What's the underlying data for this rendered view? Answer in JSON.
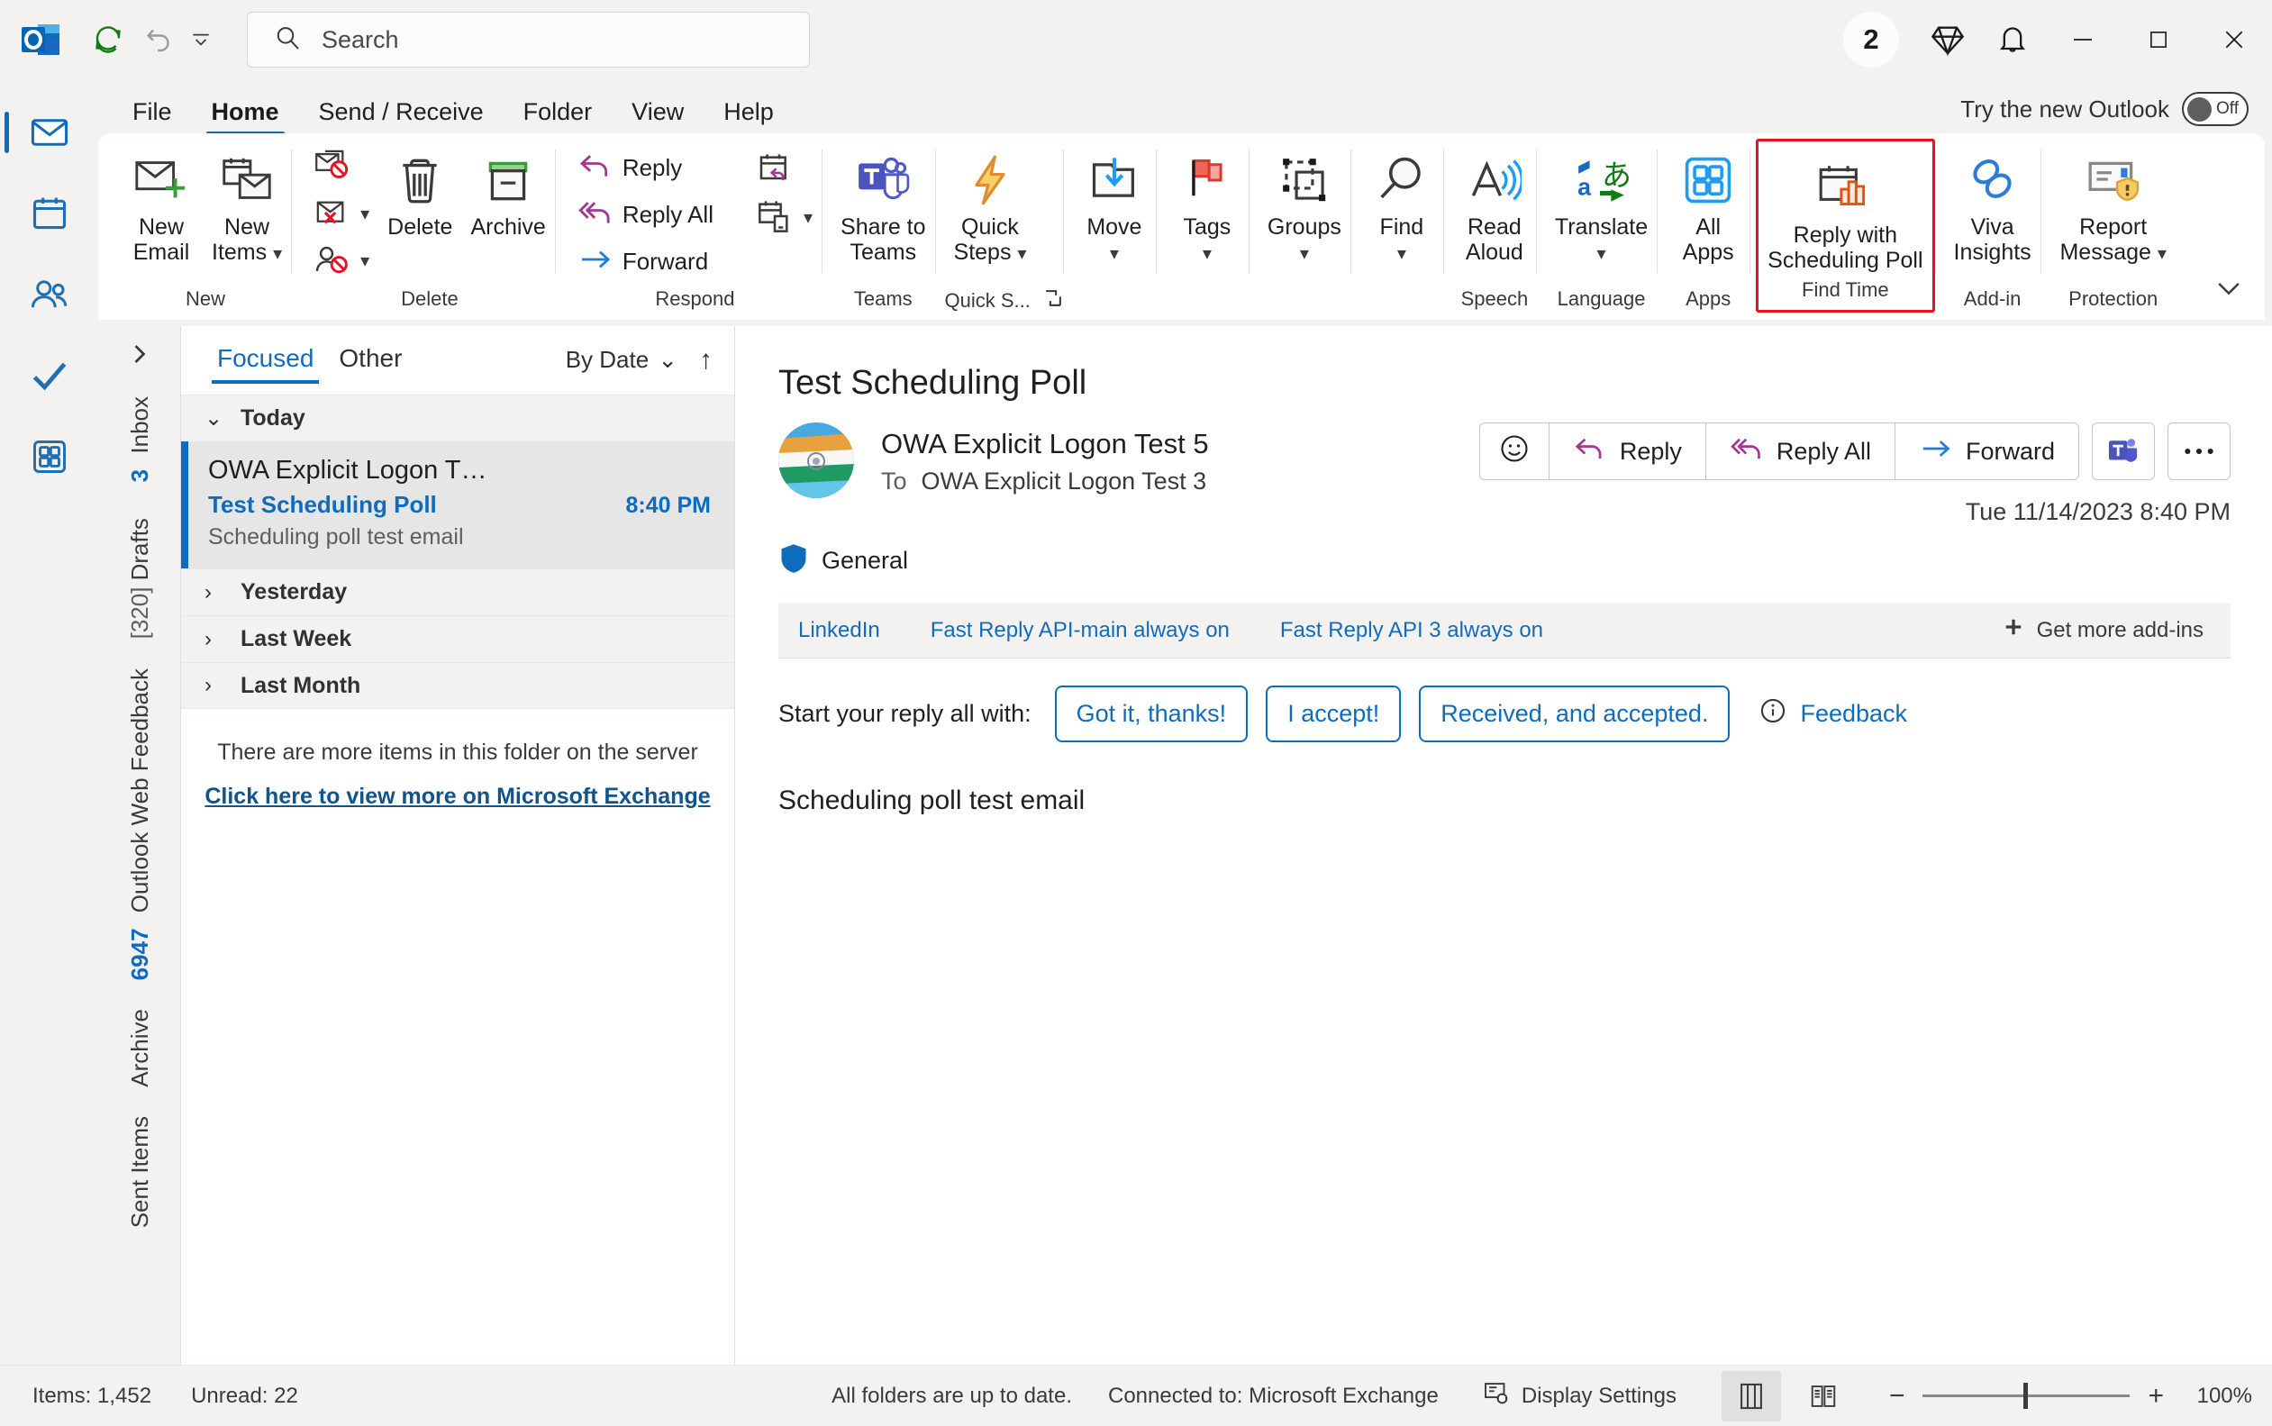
{
  "titlebar": {
    "logo_icon": "outlook-logo-icon",
    "quick_access": [
      {
        "name": "send-receive-all-icon",
        "label": "Send/Receive All Folders"
      },
      {
        "name": "undo-icon",
        "label": "Undo"
      },
      {
        "name": "customize-quick-access-toolbar-icon",
        "label": "Customize Quick Access Toolbar"
      }
    ],
    "search": {
      "placeholder": "Search",
      "icon": "search-icon"
    },
    "badge_count": "2",
    "right_icons": [
      {
        "name": "diamond-icon"
      },
      {
        "name": "bell-notification-icon"
      }
    ],
    "window_controls": {
      "minimize": "─",
      "maximize": "□",
      "close": "✕"
    }
  },
  "tabs": {
    "items": [
      {
        "label": "File",
        "active": false
      },
      {
        "label": "Home",
        "active": true
      },
      {
        "label": "Send / Receive",
        "active": false
      },
      {
        "label": "Folder",
        "active": false
      },
      {
        "label": "View",
        "active": false
      },
      {
        "label": "Help",
        "active": false
      }
    ],
    "new_outlook": {
      "label": "Try the new Outlook",
      "state": "Off"
    }
  },
  "ribbon": {
    "groups": [
      {
        "name": "new",
        "label": "New",
        "buttons": [
          {
            "name": "new-email-button",
            "label": "New\nEmail",
            "icon": "new-email-icon"
          },
          {
            "name": "new-items-button",
            "label": "New\nItems",
            "icon": "new-items-icon",
            "dropdown": true
          }
        ]
      },
      {
        "name": "delete",
        "label": "Delete",
        "small_buttons": [
          {
            "name": "ignore-button",
            "label": "",
            "icon": "ignore-icon"
          },
          {
            "name": "junk-button",
            "label": "",
            "icon": "junk-icon",
            "dropdown": true
          },
          {
            "name": "block-sender-button",
            "label": "",
            "icon": "block-sender-icon",
            "dropdown": true
          }
        ],
        "buttons": [
          {
            "name": "delete-button",
            "label": "Delete",
            "icon": "trash-icon"
          },
          {
            "name": "archive-button",
            "label": "Archive",
            "icon": "archive-box-icon"
          }
        ]
      },
      {
        "name": "respond",
        "label": "Respond",
        "small_buttons": [
          {
            "name": "reply-button",
            "label": "Reply",
            "icon": "reply-arrow-icon"
          },
          {
            "name": "reply-all-button",
            "label": "Reply All",
            "icon": "reply-all-arrow-icon"
          },
          {
            "name": "forward-button",
            "label": "Forward",
            "icon": "forward-arrow-icon"
          }
        ],
        "extra_small": [
          {
            "name": "meeting-reply-button",
            "icon": "calendar-reply-icon"
          },
          {
            "name": "more-respond-button",
            "icon": "calendar-item-icon",
            "dropdown": true
          }
        ]
      },
      {
        "name": "teams",
        "label": "Teams",
        "buttons": [
          {
            "name": "share-to-teams-button",
            "label": "Share to\nTeams",
            "icon": "teams-icon"
          }
        ]
      },
      {
        "name": "quick-steps",
        "label": "Quick S...",
        "buttons": [
          {
            "name": "quick-steps-button",
            "label": "Quick\nSteps",
            "icon": "lightning-bolt-icon",
            "dropdown": true
          }
        ],
        "dialog_launcher": true
      },
      {
        "name": "move",
        "label": "",
        "buttons": [
          {
            "name": "move-button",
            "label": "Move",
            "icon": "move-folder-icon",
            "dropdown": true
          }
        ]
      },
      {
        "name": "tags",
        "label": "",
        "buttons": [
          {
            "name": "tags-button",
            "label": "Tags",
            "icon": "flag-icon",
            "dropdown": true
          }
        ]
      },
      {
        "name": "groups",
        "label": "",
        "buttons": [
          {
            "name": "groups-button",
            "label": "Groups",
            "icon": "groups-shapes-icon",
            "dropdown": true
          }
        ]
      },
      {
        "name": "find",
        "label": "",
        "buttons": [
          {
            "name": "find-button",
            "label": "Find",
            "icon": "magnifier-icon",
            "dropdown": true
          }
        ]
      },
      {
        "name": "speech",
        "label": "Speech",
        "buttons": [
          {
            "name": "read-aloud-button",
            "label": "Read\nAloud",
            "icon": "read-aloud-icon"
          }
        ]
      },
      {
        "name": "language",
        "label": "Language",
        "buttons": [
          {
            "name": "translate-button",
            "label": "Translate",
            "icon": "translate-icon",
            "dropdown": true
          }
        ]
      },
      {
        "name": "apps",
        "label": "Apps",
        "buttons": [
          {
            "name": "all-apps-button",
            "label": "All\nApps",
            "icon": "all-apps-grid-icon"
          }
        ]
      },
      {
        "name": "find-time",
        "label": "Find Time",
        "highlighted": true,
        "buttons": [
          {
            "name": "reply-with-scheduling-poll-button",
            "label": "Reply with\nScheduling Poll",
            "icon": "scheduling-poll-icon"
          }
        ]
      },
      {
        "name": "add-in",
        "label": "Add-in",
        "buttons": [
          {
            "name": "viva-insights-button",
            "label": "Viva\nInsights",
            "icon": "viva-insights-icon"
          }
        ]
      },
      {
        "name": "protection",
        "label": "Protection",
        "buttons": [
          {
            "name": "report-message-button",
            "label": "Report\nMessage",
            "icon": "report-message-icon",
            "dropdown": true
          }
        ]
      }
    ],
    "collapse_icon": "chevron-down-icon",
    "highlight_color": "#e81123"
  },
  "nav_rail": {
    "items": [
      {
        "name": "mail",
        "icon": "mail-icon",
        "active": true
      },
      {
        "name": "calendar",
        "icon": "calendar-icon",
        "active": false
      },
      {
        "name": "people",
        "icon": "people-icon",
        "active": false
      },
      {
        "name": "to-do",
        "icon": "todo-check-icon",
        "active": false
      },
      {
        "name": "more-apps",
        "icon": "more-apps-grid-icon",
        "active": false
      }
    ]
  },
  "folder_strip": {
    "expand_icon": "chevron-right-icon",
    "folders": [
      {
        "label": "Inbox",
        "count": "3",
        "count_style": "bold-blue"
      },
      {
        "label": "Drafts",
        "count": "[320]",
        "count_style": "dim"
      },
      {
        "label": "Outlook Web Feedback",
        "count": "6947",
        "count_style": "bold-blue"
      },
      {
        "label": "Archive",
        "count": "",
        "count_style": "none"
      },
      {
        "label": "Sent Items",
        "count": "",
        "count_style": "none"
      }
    ]
  },
  "message_list": {
    "pivots": [
      {
        "label": "Focused",
        "active": true
      },
      {
        "label": "Other",
        "active": false
      }
    ],
    "sort": {
      "label": "By Date",
      "chevron": "⌄",
      "direction_icon": "↑"
    },
    "groups": [
      {
        "label": "Today",
        "expanded": true,
        "chevron": "⌄",
        "items": [
          {
            "from": "OWA Explicit Logon T…",
            "subject": "Test Scheduling Poll",
            "time": "8:40 PM",
            "preview": "Scheduling poll test email",
            "selected": true,
            "unread": true
          }
        ]
      },
      {
        "label": "Yesterday",
        "expanded": false,
        "chevron": "›",
        "items": []
      },
      {
        "label": "Last Week",
        "expanded": false,
        "chevron": "›",
        "items": []
      },
      {
        "label": "Last Month",
        "expanded": false,
        "chevron": "›",
        "items": []
      }
    ],
    "more_items_note": "There are more items in this folder on the server",
    "more_items_link": "Click here to view more on Microsoft Exchange"
  },
  "reading_pane": {
    "subject": "Test Scheduling Poll",
    "sender": "OWA Explicit Logon Test 5",
    "to_label": "To",
    "recipients": "OWA Explicit Logon Test 3",
    "date": "Tue 11/14/2023 8:40 PM",
    "sensitivity": {
      "label": "General",
      "icon": "shield-icon",
      "color": "#0f6cbd"
    },
    "actions": [
      {
        "name": "react-button",
        "label": "",
        "icon": "smiley-icon"
      },
      {
        "name": "reply-button",
        "label": "Reply",
        "icon": "reply-arrow-icon"
      },
      {
        "name": "reply-all-button",
        "label": "Reply All",
        "icon": "reply-all-arrow-icon"
      },
      {
        "name": "forward-button",
        "label": "Forward",
        "icon": "forward-arrow-icon"
      }
    ],
    "teams_button": {
      "name": "teams-meeting-button",
      "icon": "teams-icon"
    },
    "more_button": {
      "name": "more-actions-button",
      "icon": "ellipsis-icon"
    },
    "addins": [
      {
        "label": "LinkedIn"
      },
      {
        "label": "Fast Reply API-main always on"
      },
      {
        "label": "Fast Reply API 3 always on"
      }
    ],
    "get_more_addins": {
      "label": "Get more add-ins",
      "icon": "plus-icon"
    },
    "quick_reply": {
      "lead": "Start your reply all with:",
      "chips": [
        "Got it, thanks!",
        "I accept!",
        "Received, and accepted."
      ],
      "feedback": {
        "label": "Feedback",
        "icon": "info-icon"
      }
    },
    "body": "Scheduling poll test email"
  },
  "status_bar": {
    "items_count": "Items: 1,452",
    "unread_count": "Unread: 22",
    "sync_status": "All folders are up to date.",
    "connection": "Connected to: Microsoft Exchange",
    "display_settings": {
      "label": "Display Settings",
      "icon": "display-settings-icon"
    },
    "view_buttons": [
      {
        "name": "normal-view-button",
        "icon": "normal-view-icon",
        "selected": true
      },
      {
        "name": "reading-view-button",
        "icon": "reading-view-icon",
        "selected": false
      }
    ],
    "zoom": {
      "minus": "−",
      "plus": "+",
      "level": "100%"
    }
  }
}
